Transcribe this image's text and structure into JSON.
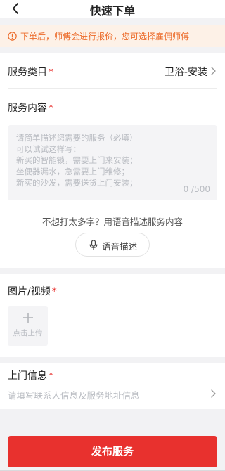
{
  "header": {
    "title": "快速下单"
  },
  "notice": {
    "text": "下单后，师傅会进行报价，您可选择雇佣师傅"
  },
  "service_category": {
    "label": "服务类目",
    "required_mark": "*",
    "value": "卫浴-安装"
  },
  "service_content": {
    "label": "服务内容",
    "required_mark": "*",
    "placeholder": "请简单描述您需要的服务（必填）\n可以试试这样写：\n新买的智能锁，需要上门来安装；\n坐便器漏水，急需要上门维修；\n新买的沙发，需要送货上门安装；",
    "counter": "0 /500"
  },
  "voice": {
    "prompt": "不想打太多字？用语音描述服务内容",
    "button_label": "语音描述"
  },
  "media": {
    "label": "图片/视频",
    "required_mark": "*",
    "upload_label": "点击上传"
  },
  "visit_info": {
    "label": "上门信息",
    "required_mark": "*",
    "placeholder": "请填写联系人信息及服务地址信息"
  },
  "submit": {
    "label": "发布服务"
  },
  "colors": {
    "accent": "#e8312e",
    "notice_text": "#ec6b2a",
    "notice_bg": "#fdf1e7"
  }
}
